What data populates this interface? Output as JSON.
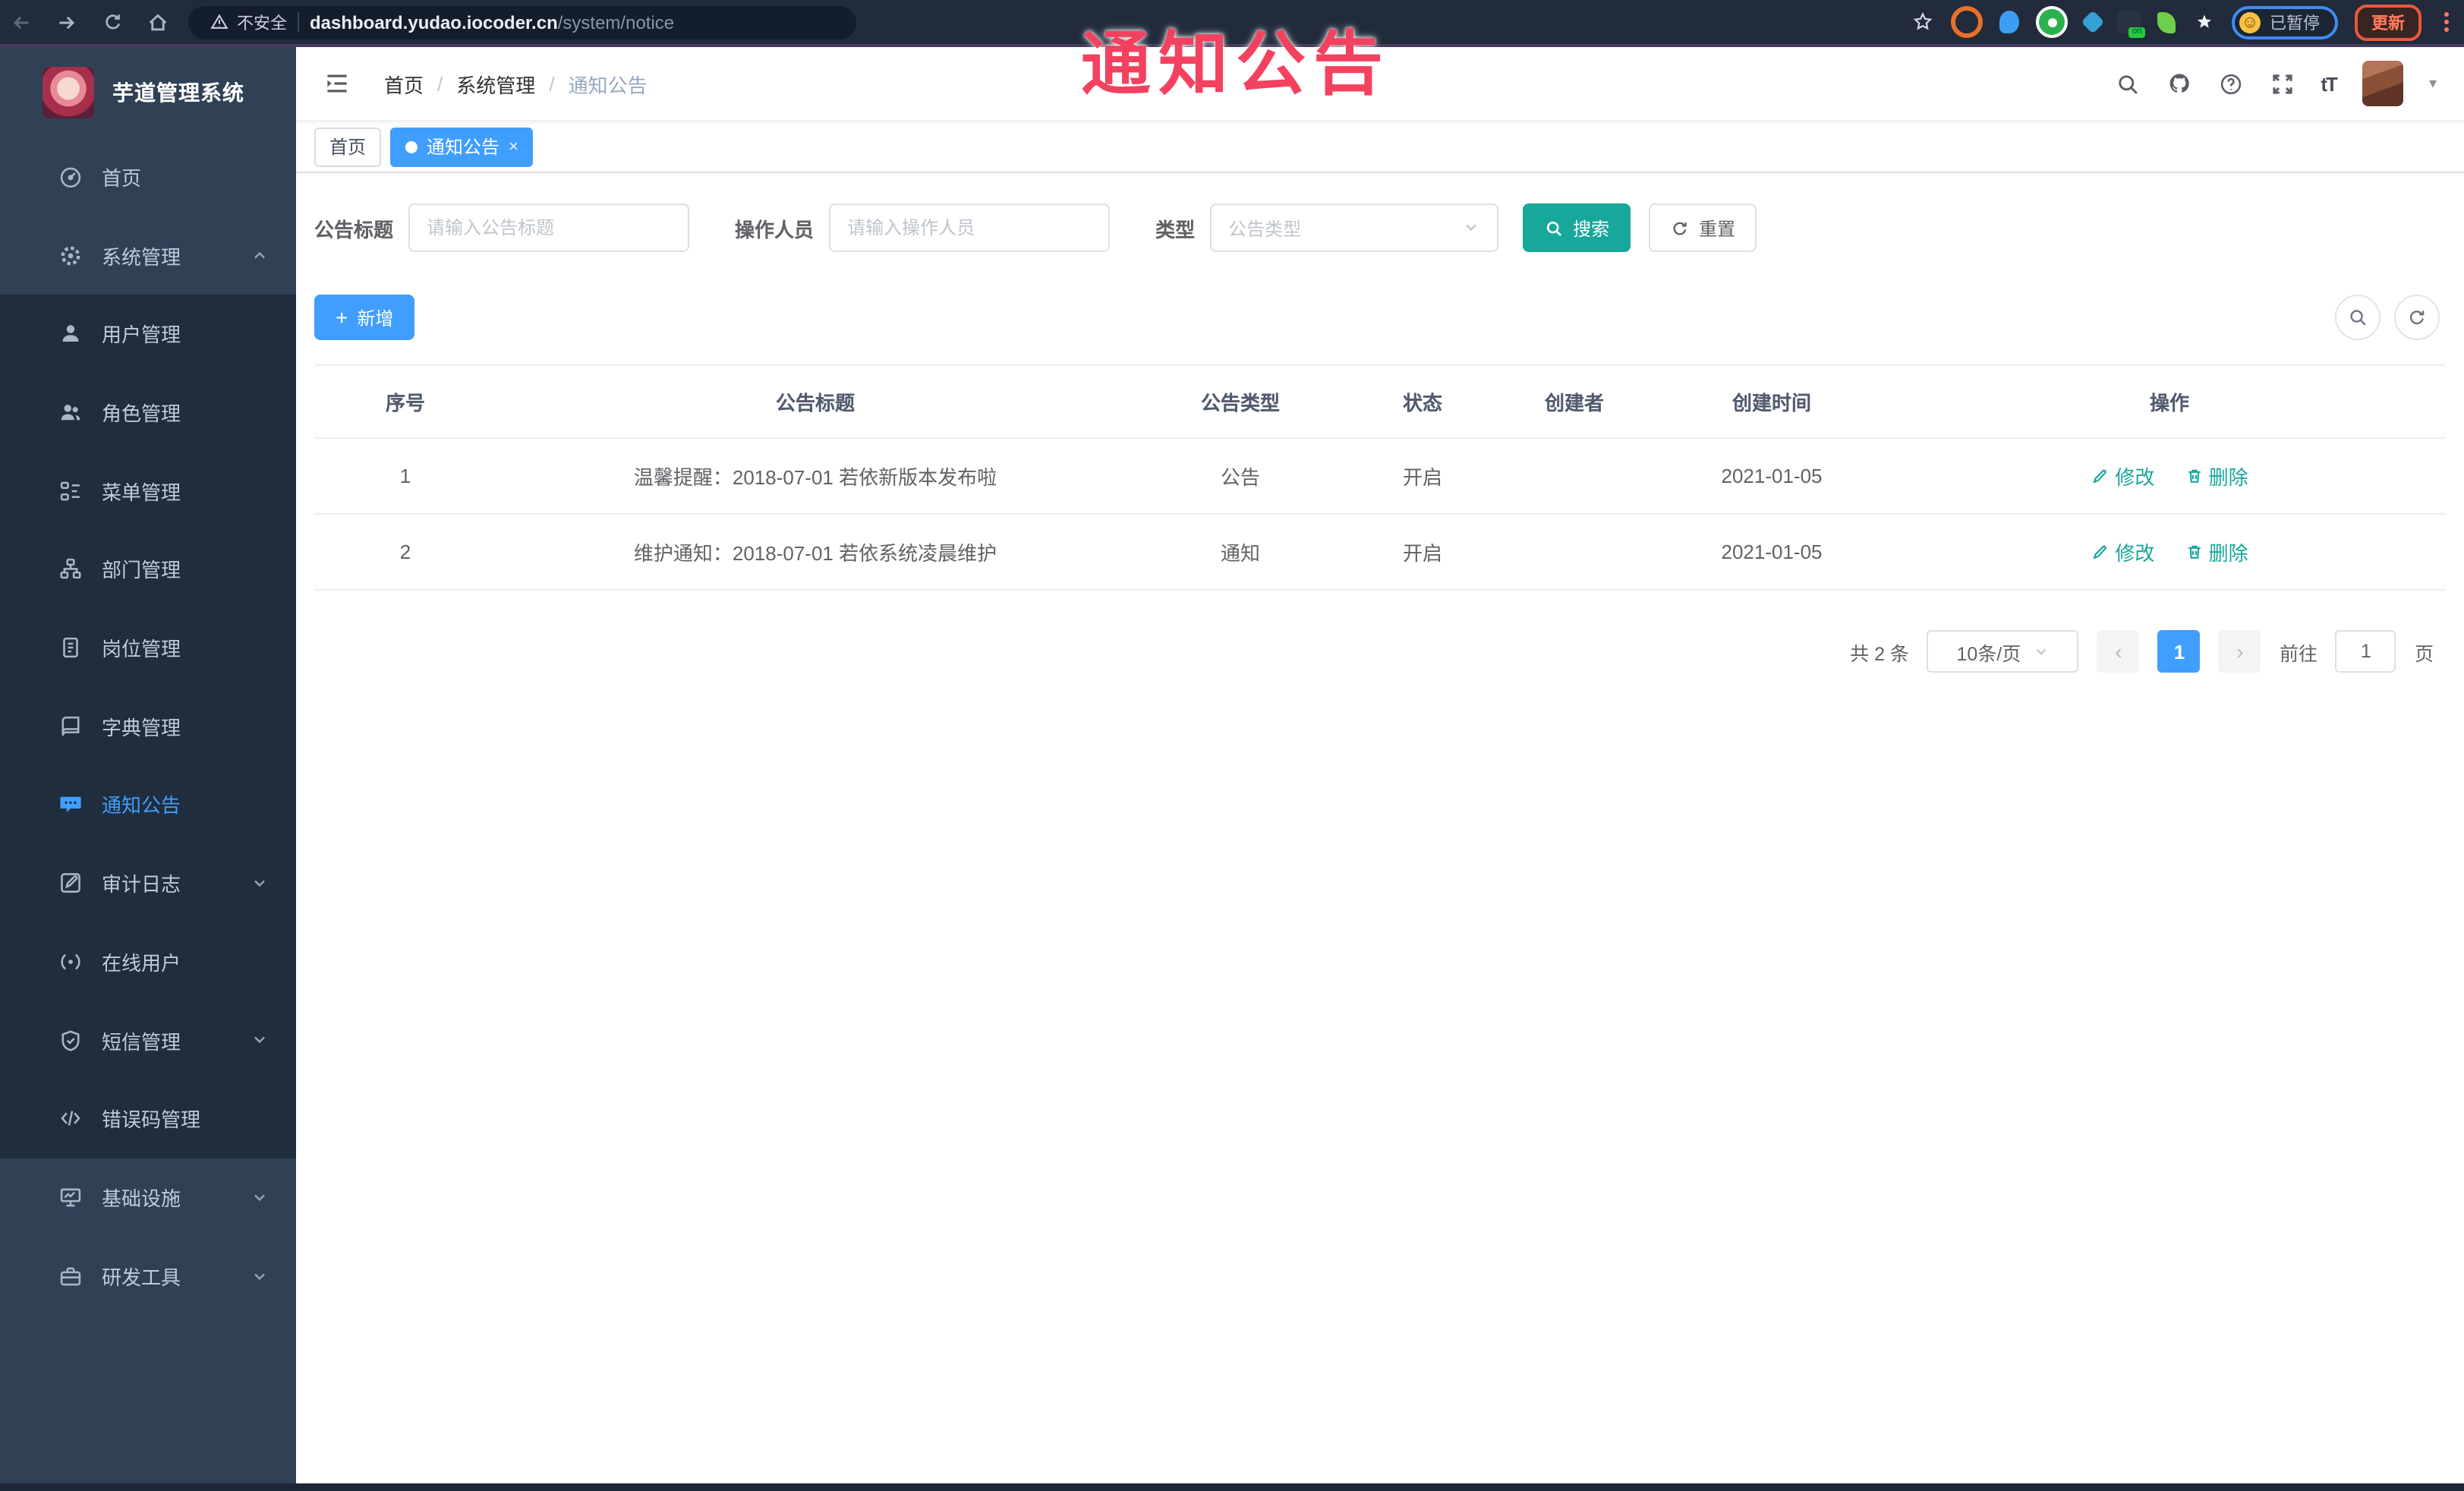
{
  "browser": {
    "security_label": "不安全",
    "url_domain": "dashboard.yudao.iocoder.cn",
    "url_path": "/system/notice",
    "paused_label": "已暂停",
    "update_label": "更新"
  },
  "overlay": {
    "title": "通知公告",
    "color": "#f4415f"
  },
  "sidebar": {
    "app_title": "芋道管理系统",
    "menu": [
      {
        "label": "首页"
      },
      {
        "label": "系统管理"
      },
      {
        "label": "用户管理"
      },
      {
        "label": "角色管理"
      },
      {
        "label": "菜单管理"
      },
      {
        "label": "部门管理"
      },
      {
        "label": "岗位管理"
      },
      {
        "label": "字典管理"
      },
      {
        "label": "通知公告"
      },
      {
        "label": "审计日志"
      },
      {
        "label": "在线用户"
      },
      {
        "label": "短信管理"
      },
      {
        "label": "错误码管理"
      },
      {
        "label": "基础设施"
      },
      {
        "label": "研发工具"
      }
    ]
  },
  "breadcrumb": {
    "items": [
      "首页",
      "系统管理",
      "通知公告"
    ],
    "separator": "/"
  },
  "tabs": [
    {
      "label": "首页"
    },
    {
      "label": "通知公告",
      "close": "×"
    }
  ],
  "filters": {
    "title_label": "公告标题",
    "title_placeholder": "请输入公告标题",
    "operator_label": "操作人员",
    "operator_placeholder": "请输入操作人员",
    "type_label": "类型",
    "type_placeholder": "公告类型",
    "search_label": "搜索",
    "reset_label": "重置"
  },
  "toolbar": {
    "add_label": "新增"
  },
  "table": {
    "headers": [
      "序号",
      "公告标题",
      "公告类型",
      "状态",
      "创建者",
      "创建时间",
      "操作"
    ],
    "rows": [
      {
        "no": "1",
        "title": "温馨提醒：2018-07-01 若依新版本发布啦",
        "type": "公告",
        "status": "开启",
        "creator": "",
        "time": "2021-01-05",
        "edit": "修改",
        "delete": "删除"
      },
      {
        "no": "2",
        "title": "维护通知：2018-07-01 若依系统凌晨维护",
        "type": "通知",
        "status": "开启",
        "creator": "",
        "time": "2021-01-05",
        "edit": "修改",
        "delete": "删除"
      }
    ]
  },
  "pagination": {
    "total": "共 2 条",
    "page_size": "10条/页",
    "prev": "‹",
    "page": "1",
    "next": "›",
    "goto_label": "前往",
    "goto_value": "1",
    "goto_suffix": "页"
  },
  "colors": {
    "primary": "#409eff",
    "teal": "#17a79b",
    "sidebar_bg": "#304156",
    "submenu_bg": "#1f2d3d",
    "active_tab": "#409eff"
  }
}
